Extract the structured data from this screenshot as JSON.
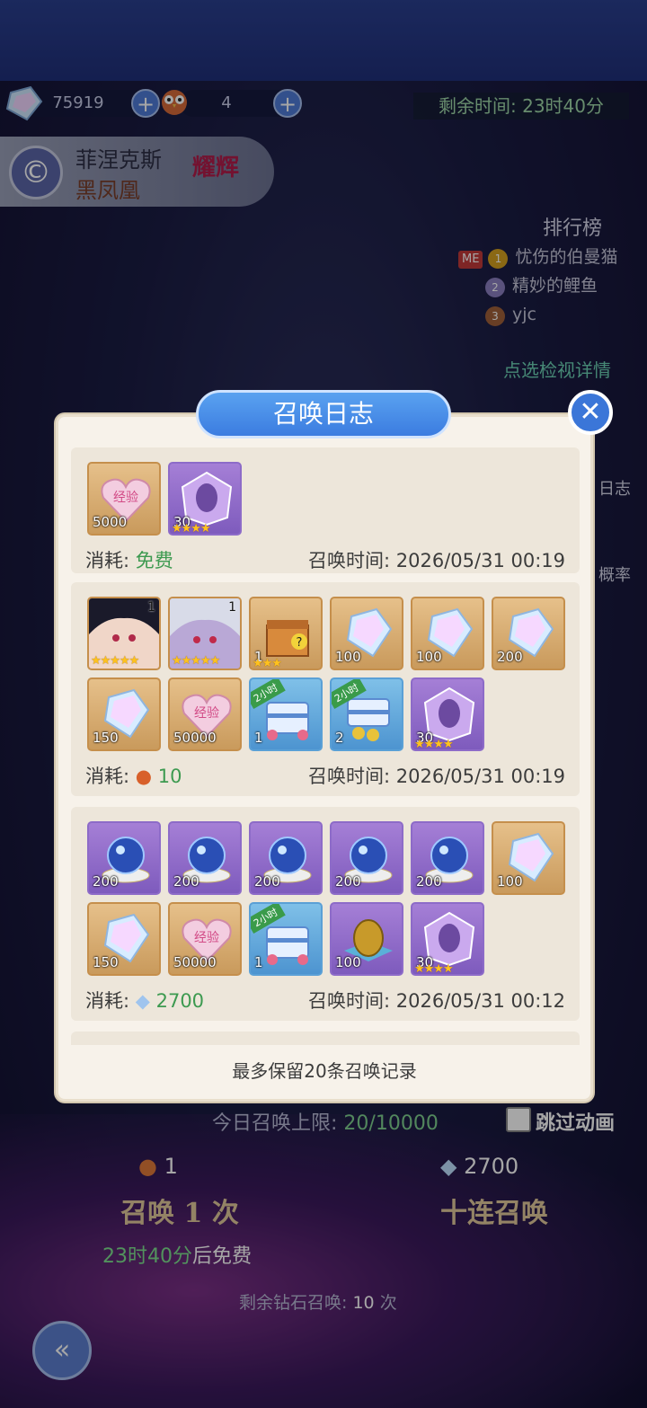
{
  "resources": {
    "diamonds": "75919",
    "tickets": "4"
  },
  "timer": {
    "label": "剩余时间:",
    "value": "23时40分"
  },
  "hero": {
    "name": "菲涅克斯",
    "subtitle": "黑凤凰",
    "rank": "耀辉"
  },
  "ranking": {
    "title": "排行榜",
    "me_label": "ME",
    "entries": [
      {
        "rank": "1",
        "name": "忧伤的伯曼猫"
      },
      {
        "rank": "2",
        "name": "精妙的鲤鱼"
      },
      {
        "rank": "3",
        "name": "yjc"
      }
    ],
    "detail_link": "点选检视详情"
  },
  "side_tabs": {
    "log": "日志",
    "prob": "概率"
  },
  "modal": {
    "title": "召唤日志",
    "cost_label": "消耗:",
    "time_label": "召唤时间:",
    "footer": "最多保留20条召唤记录",
    "records": [
      {
        "cost": "免费",
        "time": "2026/05/31 00:19",
        "items": [
          {
            "type": "exp-heart",
            "frame": "gold",
            "qty": "5000"
          },
          {
            "type": "shard",
            "frame": "purple",
            "qty": "30",
            "stars": "★★★★"
          }
        ]
      },
      {
        "cost": "10",
        "time": "2026/05/31 00:19",
        "items": [
          {
            "type": "character-1",
            "frame": "gold",
            "lvl": "1",
            "stars": "★★★★★"
          },
          {
            "type": "character-2",
            "frame": "gold",
            "lvl": "1",
            "stars": "★★★★★"
          },
          {
            "type": "mystery-box",
            "frame": "gold",
            "qty": "1",
            "stars": "★★★"
          },
          {
            "type": "diamond",
            "frame": "gold",
            "qty": "100"
          },
          {
            "type": "diamond",
            "frame": "gold",
            "qty": "100"
          },
          {
            "type": "diamond",
            "frame": "gold",
            "qty": "200"
          },
          {
            "type": "diamond",
            "frame": "gold",
            "qty": "150"
          },
          {
            "type": "exp-heart",
            "frame": "gold",
            "qty": "50000"
          },
          {
            "type": "chest-hearts",
            "frame": "blue",
            "qty": "1",
            "tag": "2小时"
          },
          {
            "type": "chest-coins",
            "frame": "blue",
            "qty": "2",
            "tag": "2小时"
          },
          {
            "type": "shard",
            "frame": "purple",
            "qty": "30",
            "stars": "★★★★"
          }
        ]
      },
      {
        "cost": "2700",
        "time": "2026/05/31 00:12",
        "items": [
          {
            "type": "crystal-orb",
            "frame": "purple",
            "qty": "200"
          },
          {
            "type": "crystal-orb",
            "frame": "purple",
            "qty": "200"
          },
          {
            "type": "crystal-orb",
            "frame": "purple",
            "qty": "200"
          },
          {
            "type": "crystal-orb",
            "frame": "purple",
            "qty": "200"
          },
          {
            "type": "crystal-orb",
            "frame": "purple",
            "qty": "200"
          },
          {
            "type": "diamond",
            "frame": "gold",
            "qty": "100"
          },
          {
            "type": "diamond",
            "frame": "gold",
            "qty": "150"
          },
          {
            "type": "exp-heart",
            "frame": "gold",
            "qty": "50000"
          },
          {
            "type": "chest-hearts",
            "frame": "blue",
            "qty": "1",
            "tag": "2小时"
          },
          {
            "type": "golden-egg",
            "frame": "purple",
            "qty": "100"
          },
          {
            "type": "shard",
            "frame": "purple",
            "qty": "30",
            "stars": "★★★★"
          }
        ]
      }
    ]
  },
  "bottom": {
    "daily_limit_label": "今日召唤上限:",
    "daily_limit_value": "20/10000",
    "skip_anim": "跳过动画",
    "single_cost": "1",
    "ten_cost": "2700",
    "single_btn": "召唤 1 次",
    "ten_btn": "十连召唤",
    "free_in": "23时40分",
    "free_suffix": "后免费",
    "remaining_label": "剩余钻石召唤:",
    "remaining_value": "10",
    "remaining_unit": "次"
  },
  "colors": {
    "accent_blue": "#3b7ce0",
    "cost_green": "#3d9a50",
    "star": "#ffc21e"
  }
}
